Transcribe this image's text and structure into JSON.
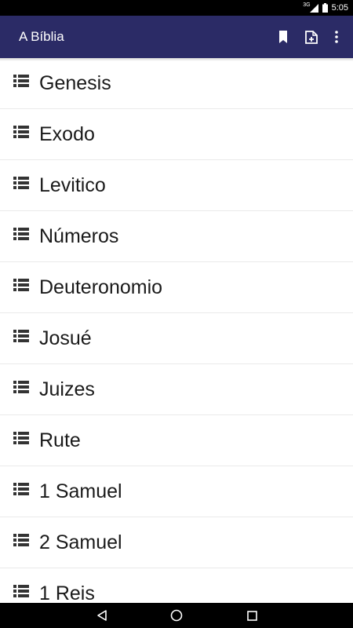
{
  "status_bar": {
    "network": "3G",
    "time": "5:05"
  },
  "app_bar": {
    "title": "A Bíblia",
    "actions": [
      {
        "icon": "bookmark-icon"
      },
      {
        "icon": "add-document-icon"
      },
      {
        "icon": "more-vert-icon"
      }
    ]
  },
  "books": [
    {
      "label": "Genesis"
    },
    {
      "label": "Exodo"
    },
    {
      "label": "Levitico"
    },
    {
      "label": "Números"
    },
    {
      "label": "Deuteronomio"
    },
    {
      "label": "Josué"
    },
    {
      "label": "Juizes"
    },
    {
      "label": "Rute"
    },
    {
      "label": "1 Samuel"
    },
    {
      "label": "2 Samuel"
    },
    {
      "label": "1 Reis"
    }
  ],
  "row_icon": "list-icon",
  "nav_bar": {
    "buttons": [
      "back-icon",
      "home-icon",
      "recents-icon"
    ]
  },
  "colors": {
    "app_bar": "#2b2b66",
    "status_bar": "#000000",
    "text": "#1a1a1a",
    "icon": "#333333"
  }
}
